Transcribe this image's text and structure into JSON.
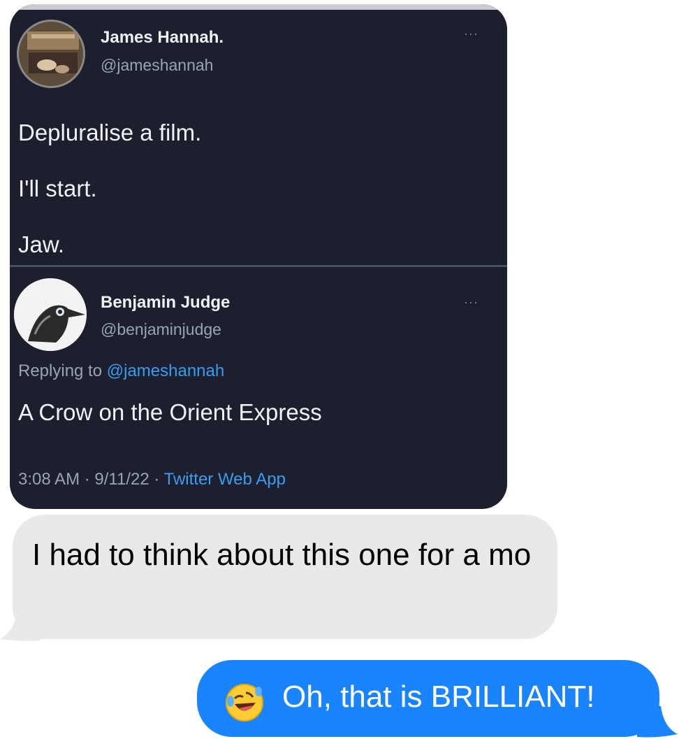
{
  "tweet1": {
    "author_name": "James Hannah.",
    "author_handle": "@jameshannah",
    "more": "···",
    "lines": [
      "Depluralise a film.",
      "I'll start.",
      "Jaw."
    ]
  },
  "tweet2": {
    "author_name": "Benjamin Judge",
    "author_handle": "@benjaminjudge",
    "more": "···",
    "replying_prefix": "Replying to",
    "replying_to": "@jameshannah",
    "text": "A Crow on the Orient Express",
    "time": "3:08 AM",
    "date": "9/11/22",
    "separator": "·",
    "client": "Twitter Web App"
  },
  "messages": {
    "received": "I had to think about this one for a mo",
    "sent": "Oh, that is BRILLIANT!",
    "sent_emoji": "rolling-on-floor-laughing-emoji"
  },
  "colors": {
    "tweet_bg": "#1c1f2e",
    "twitter_link": "#3b9cf0",
    "imessage_blue": "#1a84ff",
    "received_bubble": "#e9e9eb"
  }
}
